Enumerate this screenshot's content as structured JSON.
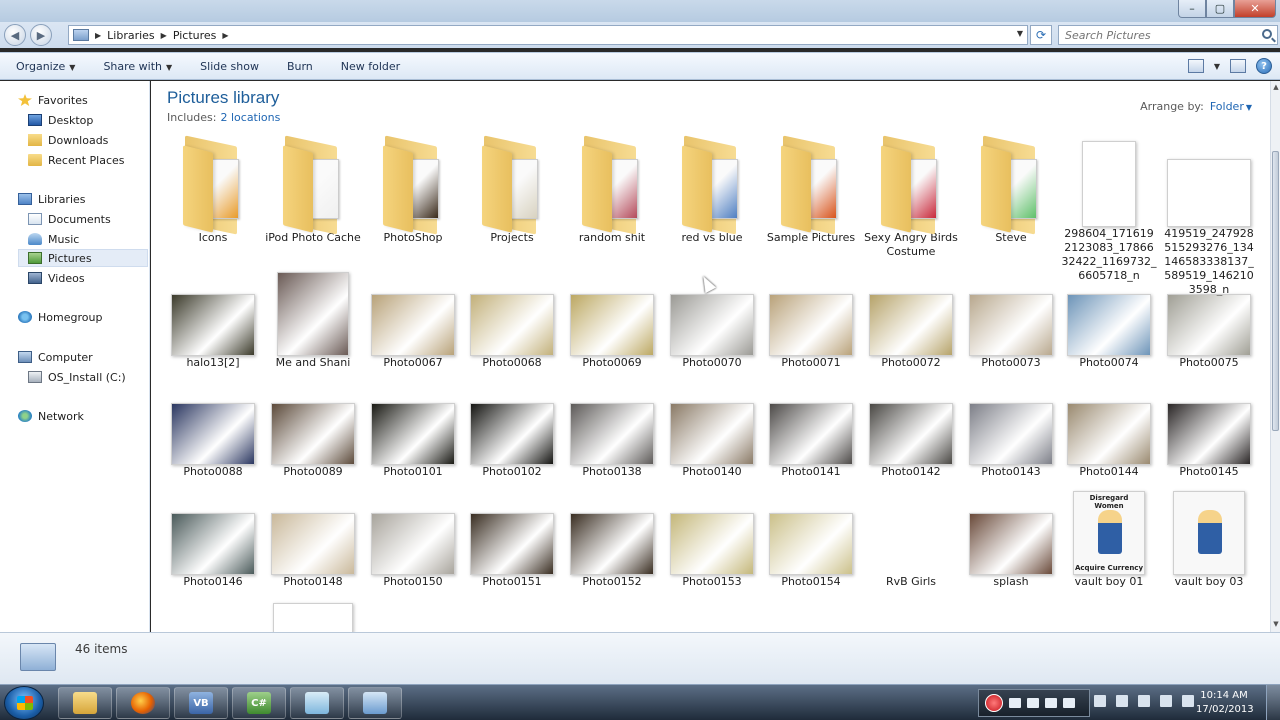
{
  "window": {
    "controls": {
      "minimize": "–",
      "maximize": "▢",
      "close": "✕"
    }
  },
  "address": {
    "segments": [
      "Libraries",
      "Pictures"
    ],
    "search_placeholder": "Search Pictures"
  },
  "toolbar": {
    "organize": "Organize",
    "share_with": "Share with",
    "slide_show": "Slide show",
    "burn": "Burn",
    "new_folder": "New folder",
    "help": "?"
  },
  "nav": {
    "favorites": "Favorites",
    "desktop": "Desktop",
    "downloads": "Downloads",
    "recent_places": "Recent Places",
    "libraries": "Libraries",
    "documents": "Documents",
    "music": "Music",
    "pictures": "Pictures",
    "videos": "Videos",
    "homegroup": "Homegroup",
    "computer": "Computer",
    "os_install": "OS_Install (C:)",
    "network": "Network"
  },
  "content": {
    "title": "Pictures library",
    "includes_label": "Includes:",
    "includes_link": "2 locations",
    "arrange_label": "Arrange by:",
    "arrange_value": "Folder"
  },
  "folders": [
    {
      "label": "Icons",
      "color": "#e89b2a"
    },
    {
      "label": "iPod Photo Cache",
      "color": "#f0f0f0"
    },
    {
      "label": "PhotoShop",
      "color": "#3a2a1a"
    },
    {
      "label": "Projects",
      "color": "#d8d2c0"
    },
    {
      "label": "random shit",
      "color": "#b44a5a"
    },
    {
      "label": "red vs blue",
      "color": "#4f7fc2"
    },
    {
      "label": "Sample Pictures",
      "color": "#d8541c"
    },
    {
      "label": "Sexy Angry Birds Costume",
      "color": "#c8283a"
    },
    {
      "label": "Steve",
      "color": "#5fc06a"
    }
  ],
  "images_row1": [
    {
      "label": "298604_1716192123083_1786632422_1169732_6605718_n",
      "color": "#2b2b2b"
    },
    {
      "label": "419519_247928515293276_134146583338137_589519_1462103598_n",
      "color": "#3a3d7a"
    }
  ],
  "photos": [
    {
      "label": "halo13[2]",
      "color": "#3b3a2a"
    },
    {
      "label": "Me and Shani",
      "color": "#6a5a55"
    },
    {
      "label": "Photo0067",
      "color": "#b8a279"
    },
    {
      "label": "Photo0068",
      "color": "#c2b07a"
    },
    {
      "label": "Photo0069",
      "color": "#bca863"
    },
    {
      "label": "Photo0070",
      "color": "#9b9a95"
    },
    {
      "label": "Photo0071",
      "color": "#b9a27a"
    },
    {
      "label": "Photo0072",
      "color": "#b6a36a"
    },
    {
      "label": "Photo0073",
      "color": "#b8a88e"
    },
    {
      "label": "Photo0074",
      "color": "#6d94b8"
    },
    {
      "label": "Photo0075",
      "color": "#a09f95"
    },
    {
      "label": "Photo0088",
      "color": "#2a3660"
    },
    {
      "label": "Photo0089",
      "color": "#5c4a3a"
    },
    {
      "label": "Photo0101",
      "color": "#1a1a14"
    },
    {
      "label": "Photo0102",
      "color": "#151512"
    },
    {
      "label": "Photo0138",
      "color": "#5d5a58"
    },
    {
      "label": "Photo0140",
      "color": "#8a7a66"
    },
    {
      "label": "Photo0141",
      "color": "#4d4a48"
    },
    {
      "label": "Photo0142",
      "color": "#4a4844"
    },
    {
      "label": "Photo0143",
      "color": "#7d7f88"
    },
    {
      "label": "Photo0144",
      "color": "#9a8a70"
    },
    {
      "label": "Photo0145",
      "color": "#2a2626"
    },
    {
      "label": "Photo0146",
      "color": "#4a5a5a"
    },
    {
      "label": "Photo0148",
      "color": "#c9b89a"
    },
    {
      "label": "Photo0150",
      "color": "#a8a49c"
    },
    {
      "label": "Photo0151",
      "color": "#3a2e22"
    },
    {
      "label": "Photo0152",
      "color": "#3a2e22"
    },
    {
      "label": "Photo0153",
      "color": "#c4b77a"
    },
    {
      "label": "Photo0154",
      "color": "#cbc08a"
    },
    {
      "label": "RvB Girls",
      "color": "#2d3a5a"
    },
    {
      "label": "splash",
      "color": "#6a4a3a"
    },
    {
      "label": "vault boy 01",
      "color": "#f2f2f2"
    },
    {
      "label": "vault boy 03",
      "color": "#f6f6f6"
    }
  ],
  "vaultboy_captions": {
    "top": "Disregard Women",
    "bottom": "Acquire Currency"
  },
  "details": {
    "count": "46 items"
  },
  "taskbar": {
    "apps": [
      "Explorer",
      "Firefox",
      "VB",
      "C#",
      "Blocks",
      "Network"
    ],
    "clock_time": "10:14 AM",
    "clock_date": "17/02/2013"
  }
}
